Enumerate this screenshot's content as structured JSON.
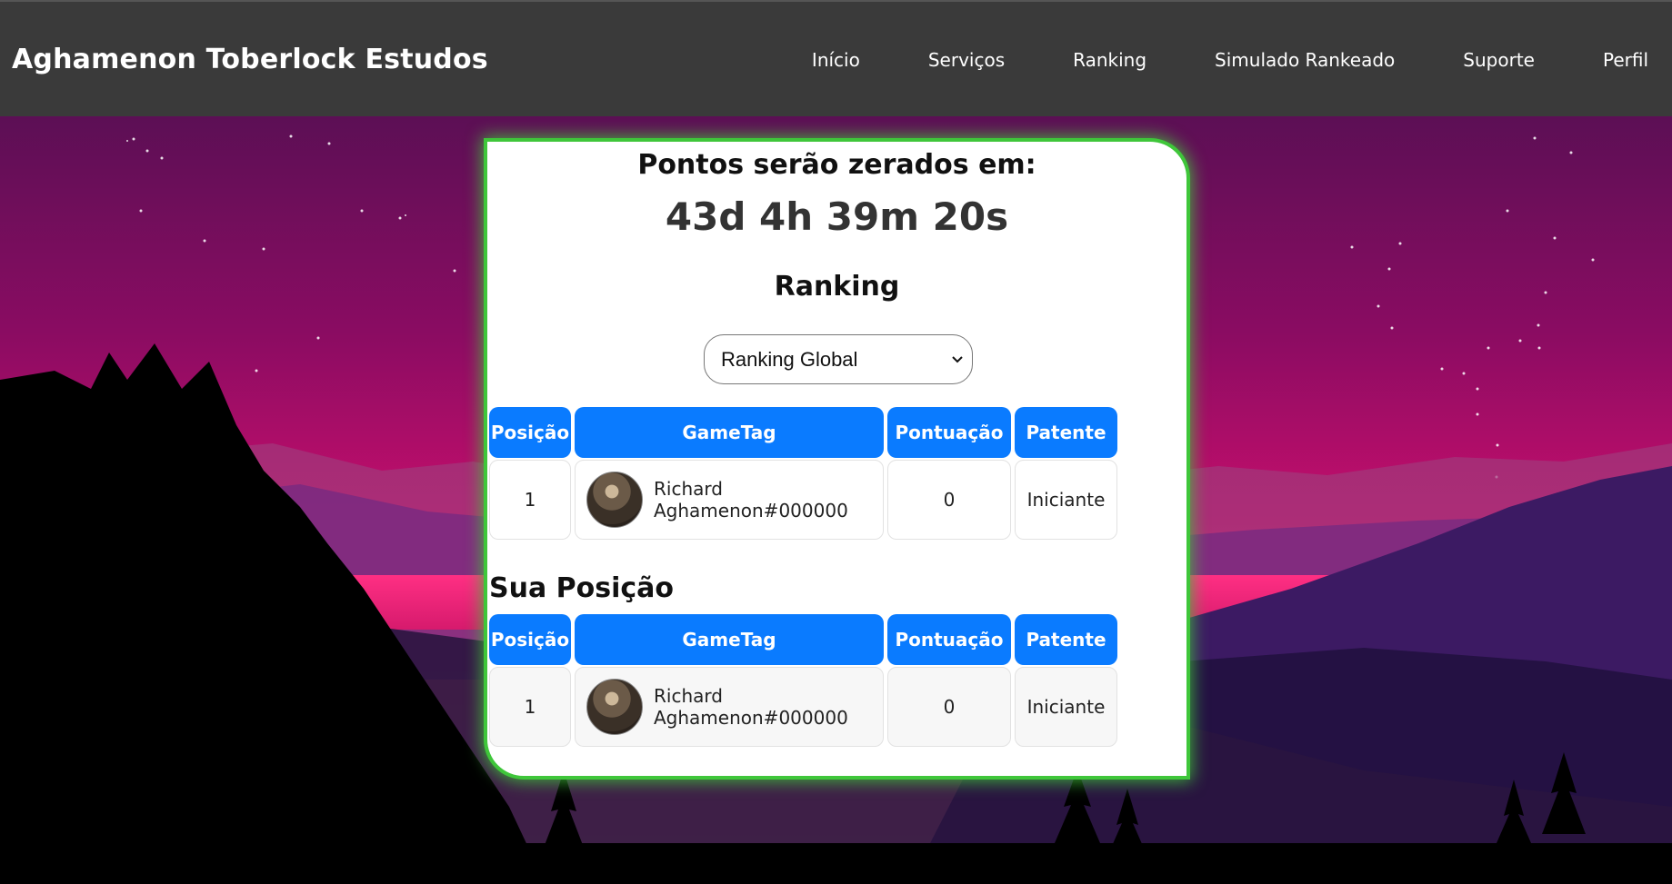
{
  "colors": {
    "navbar_bg": "#3a3a3a",
    "card_glow": "#3fc63a",
    "table_header": "#0a7bff"
  },
  "navbar": {
    "brand": "Aghamenon Toberlock Estudos",
    "links": [
      "Início",
      "Serviços",
      "Ranking",
      "Simulado Rankeado",
      "Suporte",
      "Perfil"
    ]
  },
  "card": {
    "reset_title": "Pontos serão zerados em:",
    "countdown": "43d 4h 39m 20s",
    "ranking_title": "Ranking",
    "select": {
      "selected": "Ranking Global",
      "icon": "chevron-down-icon"
    },
    "table": {
      "headers": [
        "Posição",
        "GameTag",
        "Pontuação",
        "Patente"
      ],
      "rows": [
        {
          "position": "1",
          "gametag": "Richard Aghamenon#000000",
          "score": "0",
          "rank": "Iniciante"
        }
      ]
    },
    "your_position": {
      "title": "Sua Posição",
      "headers": [
        "Posição",
        "GameTag",
        "Pontuação",
        "Patente"
      ],
      "rows": [
        {
          "position": "1",
          "gametag": "Richard Aghamenon#000000",
          "score": "0",
          "rank": "Iniciante"
        }
      ]
    }
  }
}
